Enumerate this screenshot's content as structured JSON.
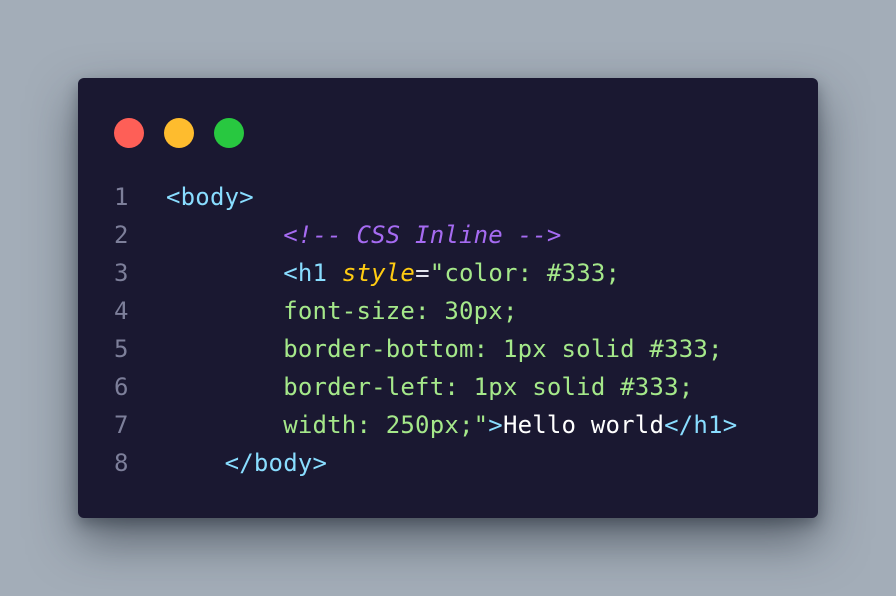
{
  "window": {
    "dots": [
      {
        "name": "close-dot",
        "color": "#fe5f57"
      },
      {
        "name": "minimize-dot",
        "color": "#febc2e"
      },
      {
        "name": "zoom-dot",
        "color": "#28c840"
      }
    ]
  },
  "colors": {
    "tag": "#89ddff",
    "comment": "#a66bf2",
    "attribute": "#ffcb12",
    "string": "#a5e88a",
    "text": "#ffffff",
    "punct": "#e2e4ee",
    "line_number": "#7d7f9a"
  },
  "code": {
    "lines": [
      {
        "number": "1",
        "indent": "",
        "tokens": [
          {
            "text": "<body>",
            "kind": "tag"
          }
        ]
      },
      {
        "number": "2",
        "indent": "        ",
        "tokens": [
          {
            "text": "<!-- CSS Inline -->",
            "kind": "comment"
          }
        ]
      },
      {
        "number": "3",
        "indent": "        ",
        "tokens": [
          {
            "text": "<h1 ",
            "kind": "tag"
          },
          {
            "text": "style",
            "kind": "attribute"
          },
          {
            "text": "=",
            "kind": "punct"
          },
          {
            "text": "\"color: #333;",
            "kind": "string"
          }
        ]
      },
      {
        "number": "4",
        "indent": "        ",
        "tokens": [
          {
            "text": "font-size: 30px;",
            "kind": "string"
          }
        ]
      },
      {
        "number": "5",
        "indent": "        ",
        "tokens": [
          {
            "text": "border-bottom: 1px solid #333;",
            "kind": "string"
          }
        ]
      },
      {
        "number": "6",
        "indent": "        ",
        "tokens": [
          {
            "text": "border-left: 1px solid #333;",
            "kind": "string"
          }
        ]
      },
      {
        "number": "7",
        "indent": "        ",
        "tokens": [
          {
            "text": "width: 250px;\"",
            "kind": "string"
          },
          {
            "text": ">",
            "kind": "tag"
          },
          {
            "text": "Hello world",
            "kind": "text"
          },
          {
            "text": "</h1>",
            "kind": "tag"
          }
        ]
      },
      {
        "number": "8",
        "indent": "    ",
        "tokens": [
          {
            "text": "</body>",
            "kind": "tag"
          }
        ]
      }
    ]
  }
}
